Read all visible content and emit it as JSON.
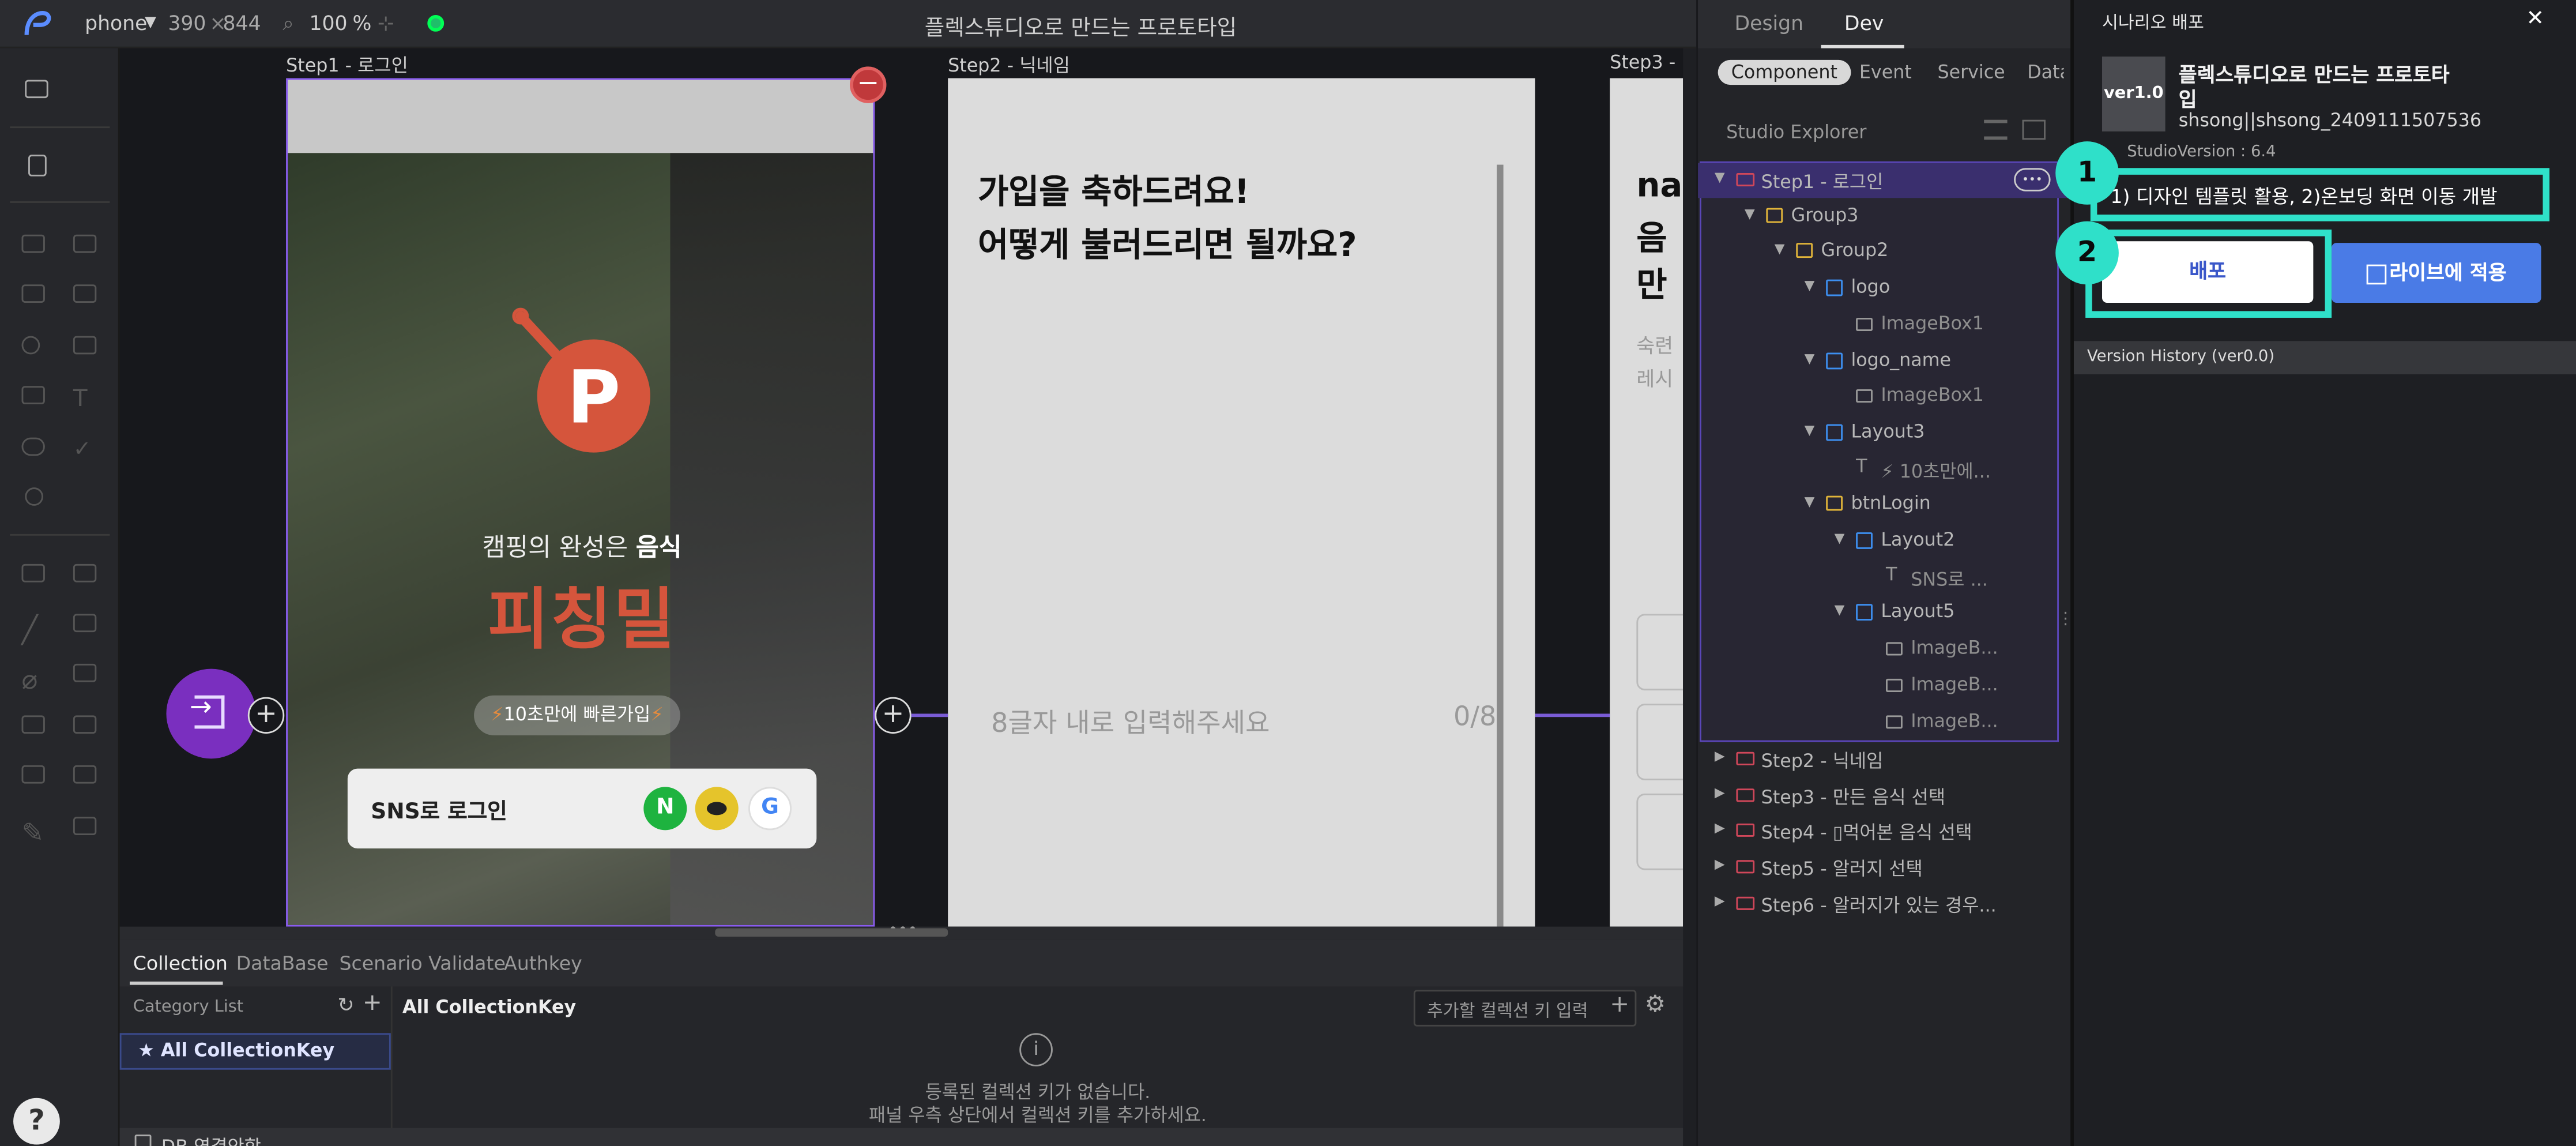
{
  "topbar": {
    "device": "phone",
    "width": "390",
    "height_sep": "×",
    "height": "844",
    "zoom": "100",
    "zoom_unit": "%",
    "title": "플렉스튜디오로 만드는 프로토타입"
  },
  "canvas": {
    "step1_label": "Step1 - 로그인",
    "step2_label": "Step2 - 닉네임",
    "step3_label": "Step3 -",
    "step1": {
      "tagline_prefix": "캠핑의 완성은 ",
      "tagline_bold": "음식",
      "brand": "피칭밀",
      "quick_badge": "10초만에 빠른가입",
      "sns_login": "SNS로 로그인",
      "naver": "N"
    },
    "step2": {
      "heading_line1": "가입을 축하드려요!",
      "heading_line2": "어떻게 불러드리면 될까요?",
      "input_placeholder": "8글자 내로 입력해주세요",
      "counter": "0/8"
    },
    "step3": {
      "partial1": "na",
      "partial2": "음",
      "partial3": "만",
      "partial4": "숙련",
      "partial5": "레시"
    }
  },
  "bottom": {
    "tabs": [
      "Collection",
      "DataBase",
      "Scenario Validate",
      "Authkey"
    ],
    "active_tab": "Collection",
    "category_list": "Category List",
    "all_collection_key": "★ All CollectionKey",
    "all_collection_heading": "All CollectionKey",
    "key_input_placeholder": "추가할 컬렉션 키 입력",
    "empty_line1": "등록된 컬렉션 키가 없습니다.",
    "empty_line2": "패널 우측 상단에서 컬렉션 키를 추가하세요.",
    "db_status": "DB 연결안함",
    "help": "?"
  },
  "rpanel": {
    "tabs": [
      "Design",
      "Dev"
    ],
    "active_tab": "Dev",
    "subtabs": [
      "Component",
      "Event",
      "Service",
      "Data"
    ],
    "active_subtab": "Component",
    "explorer_title": "Studio Explorer",
    "tree": [
      {
        "label": "Step1 - 로그인",
        "depth": 0,
        "type": "step",
        "open": true
      },
      {
        "label": "Group3",
        "depth": 1,
        "type": "folder",
        "open": true
      },
      {
        "label": "Group2",
        "depth": 2,
        "type": "folder",
        "open": true
      },
      {
        "label": "logo",
        "depth": 3,
        "type": "box",
        "open": true
      },
      {
        "label": "ImageBox1",
        "depth": 4,
        "type": "image"
      },
      {
        "label": "logo_name",
        "depth": 3,
        "type": "box",
        "open": true
      },
      {
        "label": "ImageBox1",
        "depth": 4,
        "type": "image"
      },
      {
        "label": "Layout3",
        "depth": 3,
        "type": "box",
        "open": true
      },
      {
        "label": "⚡ 10초만에...",
        "depth": 4,
        "type": "text"
      },
      {
        "label": "btnLogin",
        "depth": 3,
        "type": "folder-event",
        "open": true
      },
      {
        "label": "Layout2",
        "depth": 4,
        "type": "box",
        "open": true
      },
      {
        "label": "SNS로 ...",
        "depth": 5,
        "type": "text"
      },
      {
        "label": "Layout5",
        "depth": 4,
        "type": "box",
        "open": true
      },
      {
        "label": "ImageB...",
        "depth": 5,
        "type": "image"
      },
      {
        "label": "ImageB...",
        "depth": 5,
        "type": "image"
      },
      {
        "label": "ImageB...",
        "depth": 5,
        "type": "image"
      },
      {
        "label": "Step2 - 닉네임",
        "depth": 0,
        "type": "step",
        "open": false
      },
      {
        "label": "Step3 - 만든 음식 선택",
        "depth": 0,
        "type": "step",
        "open": false
      },
      {
        "label": "Step4 - ▯먹어본 음식 선택",
        "depth": 0,
        "type": "step",
        "open": false
      },
      {
        "label": "Step5 - 알러지 선택",
        "depth": 0,
        "type": "step",
        "open": false
      },
      {
        "label": "Step6 - 알러지가 있는 경우...",
        "depth": 0,
        "type": "step",
        "open": false
      }
    ]
  },
  "deploy": {
    "title": "시나리오 배포",
    "close": "✕",
    "version_badge": "ver1.0",
    "project_name_line1": "플렉스튜디오로 만드는 프로토타",
    "project_name_line2": "입",
    "project_id": "shsong||shsong_2409111507536",
    "studio_version": "StudioVersion : 6.4",
    "note_input": "1) 디자인 템플릿 활용, 2)온보딩 화면 이동 개발",
    "deploy_button": "배포",
    "live_button": "라이브에 적용",
    "version_history": "Version History (ver0.0)",
    "callout1": "1",
    "callout2": "2"
  },
  "colors": {
    "accent_teal": "#2fe0c9",
    "brand_red": "#d5553c",
    "live_blue": "#4a7be6",
    "purple": "#7a2fbf",
    "tree_highlight": "#3a2f6e"
  }
}
